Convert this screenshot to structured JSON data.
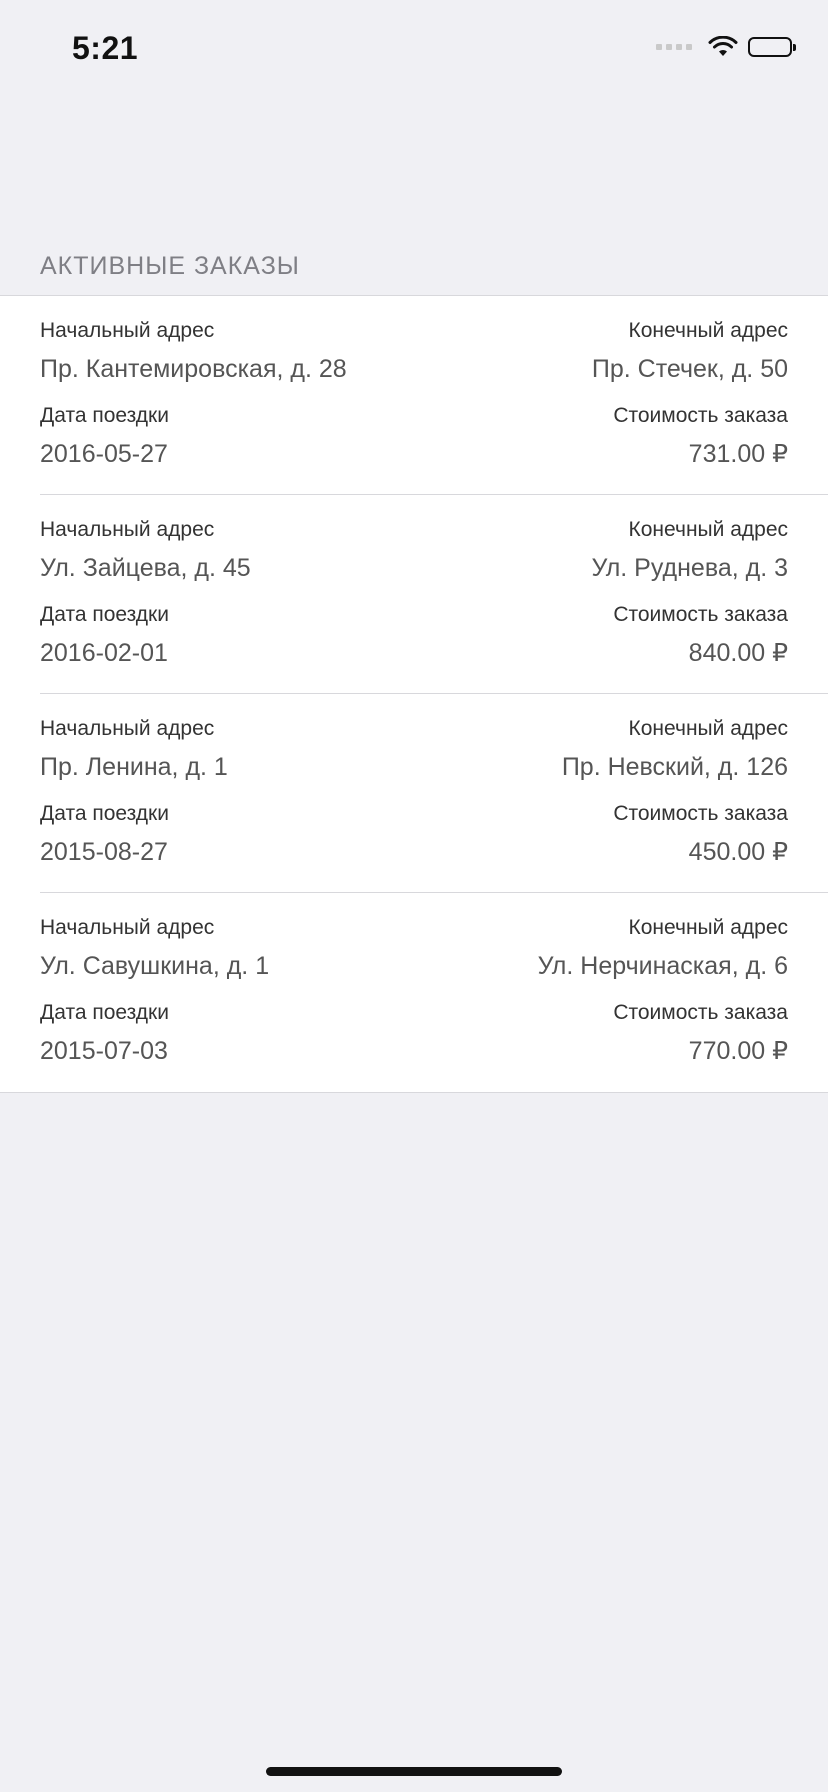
{
  "status_bar": {
    "time": "5:21"
  },
  "section": {
    "title": "АКТИВНЫЕ ЗАКАЗЫ"
  },
  "labels": {
    "start_address": "Начальный адрес",
    "end_address": "Конечный адрес",
    "trip_date": "Дата поездки",
    "order_cost": "Стоимость заказа"
  },
  "orders": [
    {
      "start_address": "Пр. Кантемировская, д. 28",
      "end_address": "Пр. Стечек, д. 50",
      "trip_date": "2016-05-27",
      "order_cost": "731.00 ₽"
    },
    {
      "start_address": "Ул. Зайцева, д. 45",
      "end_address": "Ул. Руднева, д. 3",
      "trip_date": "2016-02-01",
      "order_cost": "840.00 ₽"
    },
    {
      "start_address": "Пр. Ленина, д. 1",
      "end_address": "Пр. Невский, д. 126",
      "trip_date": "2015-08-27",
      "order_cost": "450.00 ₽"
    },
    {
      "start_address": "Ул. Савушкина, д. 1",
      "end_address": "Ул. Нерчинаская, д. 6",
      "trip_date": "2015-07-03",
      "order_cost": "770.00 ₽"
    }
  ],
  "icons": {
    "signal": "cellular-signal-icon",
    "wifi": "wifi-icon",
    "battery": "battery-icon"
  }
}
